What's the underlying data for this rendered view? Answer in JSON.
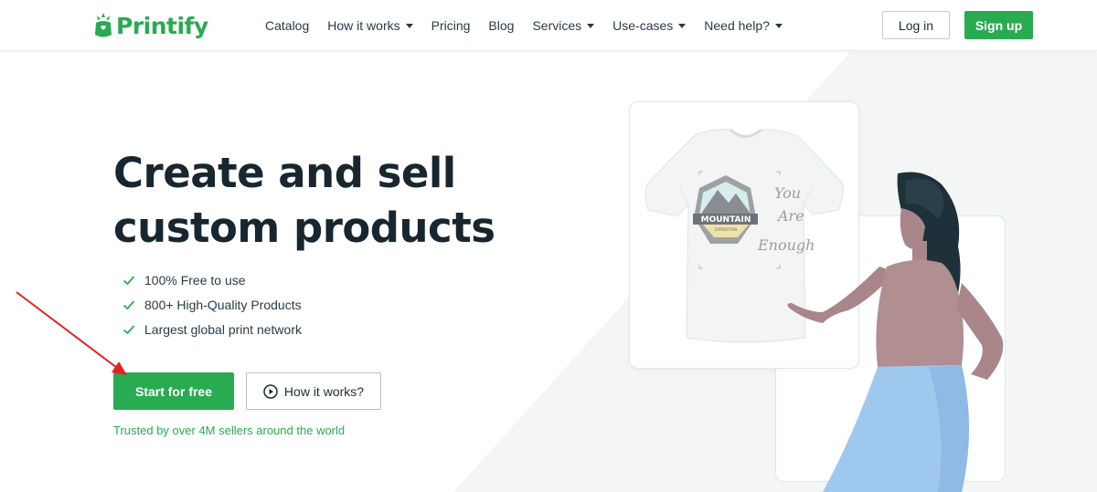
{
  "brand": {
    "name": "Printify",
    "color": "#29ab51"
  },
  "nav": {
    "items": [
      {
        "label": "Catalog",
        "dropdown": false
      },
      {
        "label": "How it works",
        "dropdown": true
      },
      {
        "label": "Pricing",
        "dropdown": false
      },
      {
        "label": "Blog",
        "dropdown": false
      },
      {
        "label": "Services",
        "dropdown": true
      },
      {
        "label": "Use-cases",
        "dropdown": true
      },
      {
        "label": "Need help?",
        "dropdown": true
      }
    ],
    "login_label": "Log in",
    "signup_label": "Sign up"
  },
  "hero": {
    "title_line1": "Create and sell",
    "title_line2": "custom products",
    "features": [
      "100% Free to use",
      "800+ High-Quality Products",
      "Largest global print network"
    ],
    "start_button": "Start for free",
    "how_button": "How it works?",
    "trusted_text": "Trusted by over 4M sellers around the world"
  },
  "illustration": {
    "badge_top": "MOUNTAIN",
    "badge_bottom": "EXPEDITION",
    "script_text": "You Are Enough"
  },
  "icons": {
    "check": "check-icon",
    "play": "play-circle-icon",
    "caret": "chevron-down-icon"
  }
}
